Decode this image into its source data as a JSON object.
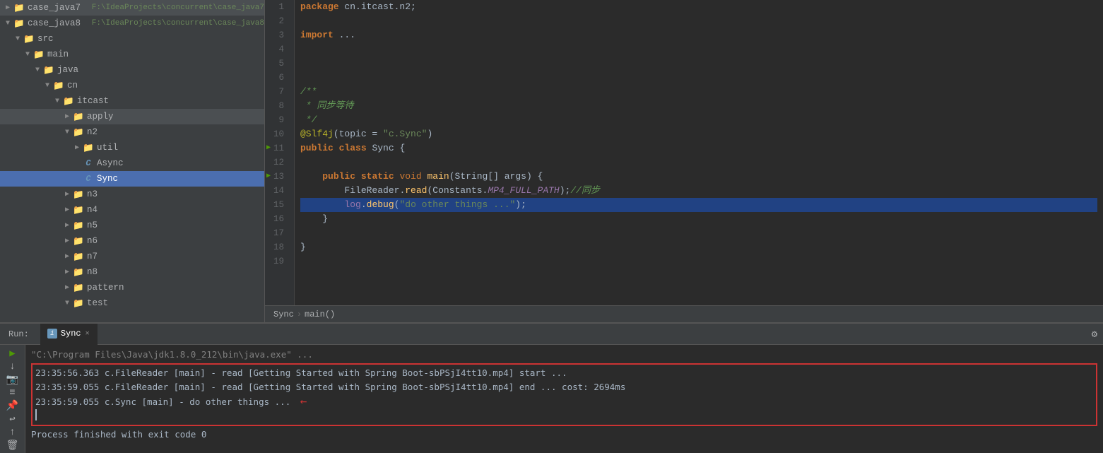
{
  "sidebar": {
    "projects": [
      {
        "name": "case_java7",
        "path": "F:\\IdeaProjects\\concurrent\\case_java7",
        "expanded": false
      },
      {
        "name": "case_java8",
        "path": "F:\\IdeaProjects\\concurrent\\case_java8",
        "expanded": true
      }
    ],
    "tree": [
      {
        "id": "case_java7",
        "label": "case_java7",
        "path": "F:\\IdeaProjects\\concurrent\\case_java7",
        "type": "project",
        "indent": 0,
        "expanded": false
      },
      {
        "id": "case_java8",
        "label": "case_java8",
        "path": "F:\\IdeaProjects\\concurrent\\case_java8",
        "type": "project",
        "indent": 0,
        "expanded": true
      },
      {
        "id": "src",
        "label": "src",
        "type": "folder",
        "indent": 1,
        "expanded": true
      },
      {
        "id": "main",
        "label": "main",
        "type": "folder",
        "indent": 2,
        "expanded": true
      },
      {
        "id": "java",
        "label": "java",
        "type": "folder",
        "indent": 3,
        "expanded": true
      },
      {
        "id": "cn",
        "label": "cn",
        "type": "folder",
        "indent": 4,
        "expanded": true
      },
      {
        "id": "itcast",
        "label": "itcast",
        "type": "folder",
        "indent": 5,
        "expanded": true
      },
      {
        "id": "apply",
        "label": "apply",
        "type": "folder",
        "indent": 6,
        "expanded": false
      },
      {
        "id": "n2",
        "label": "n2",
        "type": "folder",
        "indent": 6,
        "expanded": true
      },
      {
        "id": "util",
        "label": "util",
        "type": "folder",
        "indent": 7,
        "expanded": false
      },
      {
        "id": "Async",
        "label": "Async",
        "type": "java",
        "indent": 7,
        "selected": false
      },
      {
        "id": "Sync",
        "label": "Sync",
        "type": "java",
        "indent": 7,
        "selected": true
      },
      {
        "id": "n3",
        "label": "n3",
        "type": "folder",
        "indent": 6,
        "expanded": false
      },
      {
        "id": "n4",
        "label": "n4",
        "type": "folder",
        "indent": 6,
        "expanded": false
      },
      {
        "id": "n5",
        "label": "n5",
        "type": "folder",
        "indent": 6,
        "expanded": false
      },
      {
        "id": "n6",
        "label": "n6",
        "type": "folder",
        "indent": 6,
        "expanded": false
      },
      {
        "id": "n7",
        "label": "n7",
        "type": "folder",
        "indent": 6,
        "expanded": false
      },
      {
        "id": "n8",
        "label": "n8",
        "type": "folder",
        "indent": 6,
        "expanded": false
      },
      {
        "id": "pattern",
        "label": "pattern",
        "type": "folder",
        "indent": 6,
        "expanded": false
      },
      {
        "id": "test",
        "label": "test",
        "type": "folder",
        "indent": 6,
        "expanded": false
      }
    ]
  },
  "editor": {
    "lines": [
      {
        "num": 1,
        "code": "package cn.itcast.n2;"
      },
      {
        "num": 2,
        "code": ""
      },
      {
        "num": 3,
        "code": "import ..."
      },
      {
        "num": 4,
        "code": ""
      },
      {
        "num": 5,
        "code": ""
      },
      {
        "num": 6,
        "code": ""
      },
      {
        "num": 7,
        "code": "/**"
      },
      {
        "num": 8,
        "code": " * 同步等待"
      },
      {
        "num": 9,
        "code": " */"
      },
      {
        "num": 10,
        "code": "@Slf4j(topic = \"c.Sync\")"
      },
      {
        "num": 11,
        "code": "public class Sync {",
        "runnable": true
      },
      {
        "num": 12,
        "code": ""
      },
      {
        "num": 13,
        "code": "    public static void main(String[] args) {",
        "runnable": true
      },
      {
        "num": 14,
        "code": "        FileReader.read(Constants.MP4_FULL_PATH);//同步"
      },
      {
        "num": 15,
        "code": "        log.debug(\"do other things ...\");",
        "highlighted": true,
        "hint": true
      },
      {
        "num": 16,
        "code": "    }"
      },
      {
        "num": 17,
        "code": ""
      },
      {
        "num": 18,
        "code": "}"
      },
      {
        "num": 19,
        "code": ""
      }
    ],
    "breadcrumb": {
      "file": "Sync",
      "method": "main()"
    }
  },
  "run_panel": {
    "tab_label": "Sync",
    "cmd_line": "\"C:\\Program Files\\Java\\jdk1.8.0_212\\bin\\java.exe\" ...",
    "log_lines": [
      "23:35:56.363 c.FileReader [main] - read [Getting Started with Spring Boot-sbPSjI4tt10.mp4] start ...",
      "23:35:59.055 c.FileReader [main] - read [Getting Started with Spring Boot-sbPSjI4tt10.mp4] end ... cost: 2694ms",
      "23:35:59.055 c.Sync [main] - do other things ..."
    ],
    "finish_line": "Process finished with exit code 0",
    "sidebar_buttons": [
      "run",
      "down",
      "snapshot",
      "list",
      "pin",
      "scroll",
      "up",
      "trash"
    ]
  }
}
